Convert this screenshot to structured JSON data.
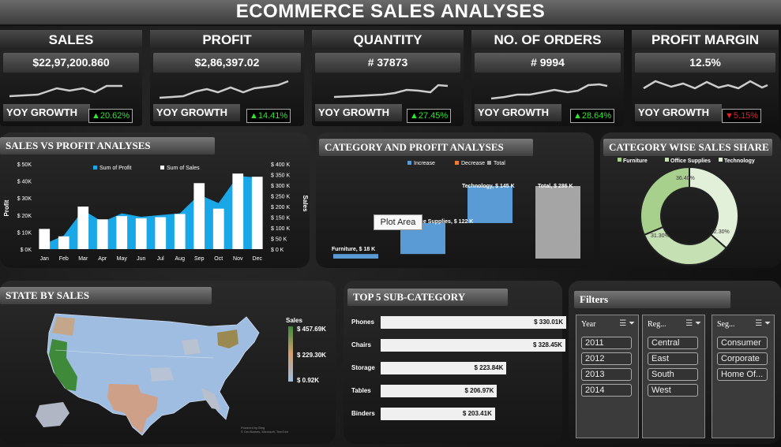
{
  "title": "ECOMMERCE SALES ANALYSES",
  "kpis": [
    {
      "label": "SALES",
      "value": "$22,97,200.860",
      "yoy_label": "YOY GROWTH",
      "yoy": "20.62%",
      "dir": "up"
    },
    {
      "label": "PROFIT",
      "value": "$2,86,397.02",
      "yoy_label": "YOY GROWTH",
      "yoy": "14.41%",
      "dir": "up"
    },
    {
      "label": "QUANTITY",
      "value": "# 37873",
      "yoy_label": "YOY GROWTH",
      "yoy": "27.45%",
      "dir": "up"
    },
    {
      "label": "NO. OF ORDERS",
      "value": "# 9994",
      "yoy_label": "YOY GROWTH",
      "yoy": "28.64%",
      "dir": "up"
    },
    {
      "label": "PROFIT MARGIN",
      "value": "12.5%",
      "yoy_label": "YOY GROWTH",
      "yoy": "5.15%",
      "dir": "down"
    }
  ],
  "sales_profit": {
    "title": "SALES VS PROFIT ANALYSES",
    "legend_profit": "Sum of Profit",
    "legend_sales": "Sum of Sales",
    "ylabel_left": "Profit",
    "ylabel_right": "Sales",
    "months": [
      "Jan",
      "Feb",
      "Mar",
      "Apr",
      "May",
      "Jun",
      "Jul",
      "Aug",
      "Sep",
      "Oct",
      "Nov",
      "Dec"
    ],
    "left_ticks": [
      "$ 0K",
      "$ 10K",
      "$ 20K",
      "$ 30K",
      "$ 40K",
      "$ 50K"
    ],
    "right_ticks": [
      "$ 0 K",
      "$ 50 K",
      "$ 100 K",
      "$ 150 K",
      "$ 200 K",
      "$ 250 K",
      "$ 300 K",
      "$ 350 K",
      "$ 400 K"
    ]
  },
  "category_profit": {
    "title": "CATEGORY AND PROFIT ANALYSES",
    "legend": [
      "Increase",
      "Decrease",
      "Total"
    ],
    "labels": [
      "Furniture, $ 18 K",
      "Office Supplies, $ 122 K",
      "Technology, $ 145 K",
      "Total, $ 286 K"
    ],
    "tooltip": "Plot Area"
  },
  "category_share": {
    "title": "CATEGORY WISE SALES SHARE",
    "legend": [
      "Furniture",
      "Office Supplies",
      "Technology"
    ],
    "labels": [
      "36.40%",
      "32.30%",
      "31.30%"
    ]
  },
  "state_sales": {
    "title": "STATE BY SALES",
    "legend_title": "Sales",
    "legend_values": [
      "$ 457.69K",
      "$ 229.30K",
      "$ 0.92K"
    ],
    "credit": "Powered by Bing\n© GeoNames, Microsoft, TomTom"
  },
  "top5": {
    "title": "TOP 5 SUB-CATEGORY",
    "items": [
      {
        "name": "Phones",
        "label": "$ 330.01K"
      },
      {
        "name": "Chairs",
        "label": "$ 328.45K"
      },
      {
        "name": "Storage",
        "label": "$ 223.84K"
      },
      {
        "name": "Tables",
        "label": "$ 206.97K"
      },
      {
        "name": "Binders",
        "label": "$ 203.41K"
      }
    ]
  },
  "filters": {
    "title": "Filters",
    "year": {
      "head": "Year",
      "items": [
        "2011",
        "2012",
        "2013",
        "2014"
      ]
    },
    "region": {
      "head": "Reg...",
      "items": [
        "Central",
        "East",
        "South",
        "West"
      ]
    },
    "segment": {
      "head": "Seg...",
      "items": [
        "Consumer",
        "Corporate",
        "Home Of..."
      ]
    }
  },
  "chart_data": [
    {
      "type": "bar",
      "title": "SALES VS PROFIT ANALYSES",
      "categories": [
        "Jan",
        "Feb",
        "Mar",
        "Apr",
        "May",
        "Jun",
        "Jul",
        "Aug",
        "Sep",
        "Oct",
        "Nov",
        "Dec"
      ],
      "series": [
        {
          "name": "Sum of Sales",
          "type": "bar",
          "axis": "right",
          "values": [
            95,
            60,
            200,
            140,
            155,
            145,
            150,
            165,
            310,
            190,
            355,
            340
          ]
        },
        {
          "name": "Sum of Profit",
          "type": "area",
          "axis": "left",
          "values": [
            3,
            8,
            23,
            16,
            21,
            19,
            20,
            21,
            32,
            27,
            43,
            42
          ]
        }
      ],
      "ylim_left": [
        0,
        50
      ],
      "ylim_right": [
        0,
        400
      ],
      "color_sales": "#ffffff",
      "color_profit": "#1aa7e8"
    },
    {
      "type": "bar",
      "title": "CATEGORY AND PROFIT ANALYSES",
      "subtype": "waterfall",
      "categories": [
        "Furniture",
        "Office Supplies",
        "Technology",
        "Total"
      ],
      "values": [
        18,
        122,
        145,
        286
      ],
      "colors": {
        "increase": "#5b9bd5",
        "decrease": "#ed7d31",
        "total": "#a5a5a5"
      }
    },
    {
      "type": "pie",
      "title": "CATEGORY WISE SALES SHARE",
      "categories": [
        "Technology",
        "Office Supplies",
        "Furniture"
      ],
      "values": [
        36.4,
        32.3,
        31.3
      ],
      "colors": [
        "#e2efd9",
        "#c5e0b3",
        "#a8d08d"
      ]
    },
    {
      "type": "bar",
      "title": "TOP 5 SUB-CATEGORY",
      "categories": [
        "Phones",
        "Chairs",
        "Storage",
        "Tables",
        "Binders"
      ],
      "values": [
        330.01,
        328.45,
        223.84,
        206.97,
        203.41
      ]
    }
  ]
}
